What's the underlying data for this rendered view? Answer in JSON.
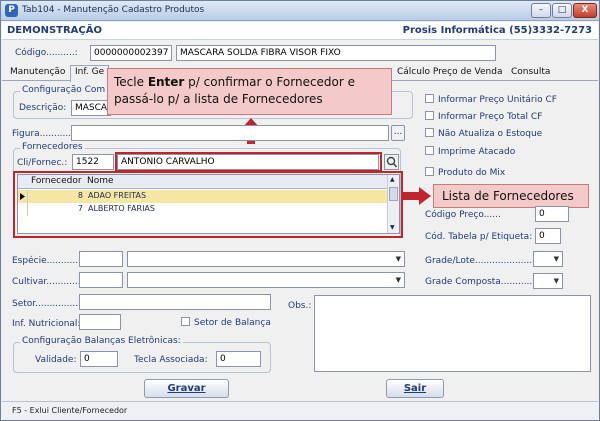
{
  "window": {
    "title": "Tab104 - Manutenção Cadastro Produtos",
    "app_icon": "P",
    "buttons": {
      "minimize": "–",
      "maximize": "□",
      "close": "X"
    }
  },
  "header": {
    "left": "DEMONSTRAÇÃO",
    "right": "Prosis Informática (55)3332-7273"
  },
  "codigo": {
    "label": "Código..........:",
    "value": "0000000002397",
    "description": "MASCARA SOLDA FIBRA VISOR FIXO"
  },
  "tabs": [
    {
      "label": "Manutenção"
    },
    {
      "label": "Inf. Ge"
    },
    {
      "label": "Cálculo Preço de Venda"
    },
    {
      "label": "Consulta"
    }
  ],
  "config_group": {
    "title": "Configuração Com",
    "descricao_label": "Descrição:",
    "descricao_value": "MASCA"
  },
  "figura": {
    "label": "Figura..............:",
    "button": "..."
  },
  "fornecedores": {
    "title": "Fornecedores",
    "cli_label": "Cli/Fornec.:",
    "code_value": "1522",
    "name_value": "ANTONIO CARVALHO",
    "columns": [
      "Fornecedor",
      "Nome"
    ],
    "rows": [
      {
        "code": "8",
        "name": "ADAO FREITAS",
        "selected": true
      },
      {
        "code": "7",
        "name": "ALBERTO FARIAS",
        "selected": false
      }
    ]
  },
  "callouts": {
    "tooltip_part1": "Tecle ",
    "tooltip_bold": "Enter",
    "tooltip_part2": " p/ confirmar o Fornecedor e passá-lo p/ a lista de Fornecedores",
    "lista": "Lista de Fornecedores"
  },
  "checkboxes": [
    {
      "label": "Informar Preço Unitário CF"
    },
    {
      "label": "Informar Preço Total CF"
    },
    {
      "label": "Não Atualiza o Estoque"
    },
    {
      "label": "Imprime Atacado"
    },
    {
      "label": "Produto do Mix"
    }
  ],
  "right_fields": {
    "codigo_preco_label": "Código Preço......",
    "codigo_preco_value": "0",
    "cod_tabela_label": "Cód. Tabela p/ Etiqueta:",
    "cod_tabela_value": "0",
    "grade_lote_label": "Grade/Lote......................:",
    "grade_composta_label": "Grade Composta...........:"
  },
  "left_fields": {
    "especie_label": "Espécie...............:",
    "cultivar_label": "Cultivar...............:",
    "setor_label": "Setor...............:",
    "inf_nutricional_label": "Inf. Nutricional:",
    "setor_balanca_label": "Setor de Balança",
    "obs_label": "Obs.:"
  },
  "balancas": {
    "title": "Configuração Balanças Eletrônicas:",
    "validade_label": "Validade:",
    "validade_value": "0",
    "tecla_label": "Tecla Associada:",
    "tecla_value": "0"
  },
  "buttons": {
    "gravar": "Gravar",
    "sair": "Sair"
  },
  "status_bar": "F5 - Exlui Cliente/Fornecedor",
  "colors": {
    "accent_red": "#c0242d",
    "label_blue": "#1f3b78",
    "tooltip_bg": "#f3c9c9",
    "row_selected": "#f6e6a3"
  }
}
